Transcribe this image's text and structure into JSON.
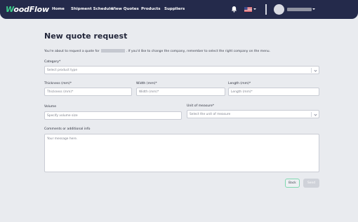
{
  "brand": {
    "logo_prefix": "W",
    "logo_rest": "oodFlow"
  },
  "nav": {
    "items": [
      "Home",
      "Shipment Schedule",
      "View Quotes",
      "Products",
      "Suppliers"
    ]
  },
  "header_icons": [
    "bell-icon",
    "us-flag-icon",
    "avatar-icon",
    "chevron-down-icon"
  ],
  "page": {
    "title": "New quote request",
    "intro_before": "You're about to request a quote for",
    "intro_after": ". If you'd like to change the company, remember to select the right company on the menu."
  },
  "form": {
    "category": {
      "label": "Category*",
      "placeholder": "Select product type"
    },
    "thickness": {
      "label": "Thickness (mm)*",
      "placeholder": "Thickness (mm)*"
    },
    "width": {
      "label": "Width (mm)*",
      "placeholder": "Width (mm)*"
    },
    "length": {
      "label": "Length (mm)*",
      "placeholder": "Length (mm)*"
    },
    "volume": {
      "label": "Volume",
      "placeholder": "Specify volume size"
    },
    "unit": {
      "label": "Unit of measure*",
      "placeholder": "Select the unit of measure"
    },
    "comments": {
      "label": "Comments or additional info",
      "placeholder": "Your message here."
    }
  },
  "actions": {
    "back_label": "Back",
    "send_label": "Send"
  },
  "colors": {
    "navbar": "#242a4b",
    "accent": "#3ecf8e",
    "background": "#e9ebef"
  }
}
